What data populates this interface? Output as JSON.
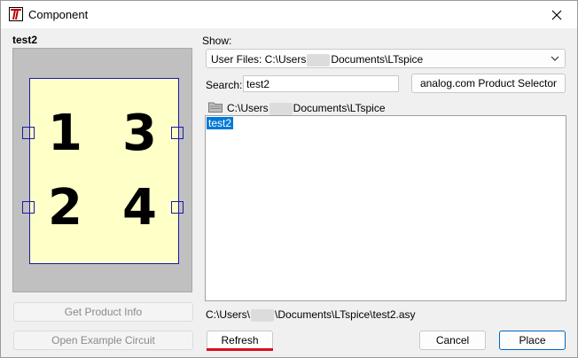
{
  "window": {
    "title": "Component"
  },
  "preview": {
    "name": "test2",
    "pins": [
      "1",
      "3",
      "2",
      "4"
    ]
  },
  "show": {
    "label": "Show:",
    "selected_prefix": "User Files: C:\\Users",
    "selected_suffix": "Documents\\LTspice"
  },
  "search": {
    "label": "Search:",
    "value": "test2"
  },
  "product_selector_label": "analog.com Product Selector",
  "folder": {
    "prefix": "C:\\Users",
    "suffix": "Documents\\LTspice"
  },
  "list": {
    "items": [
      "test2"
    ]
  },
  "path": {
    "prefix": "C:\\Users\\",
    "suffix": "\\Documents\\LTspice\\test2.asy"
  },
  "buttons": {
    "get_product_info": "Get Product Info",
    "open_example": "Open Example Circuit",
    "refresh": "Refresh",
    "cancel": "Cancel",
    "place": "Place"
  },
  "colors": {
    "symbol_fill": "#ffffc8",
    "symbol_border": "#1a1aa8",
    "selection": "#0078d7",
    "accent_underline": "#d90e1d",
    "primary_border": "#0067c0"
  }
}
